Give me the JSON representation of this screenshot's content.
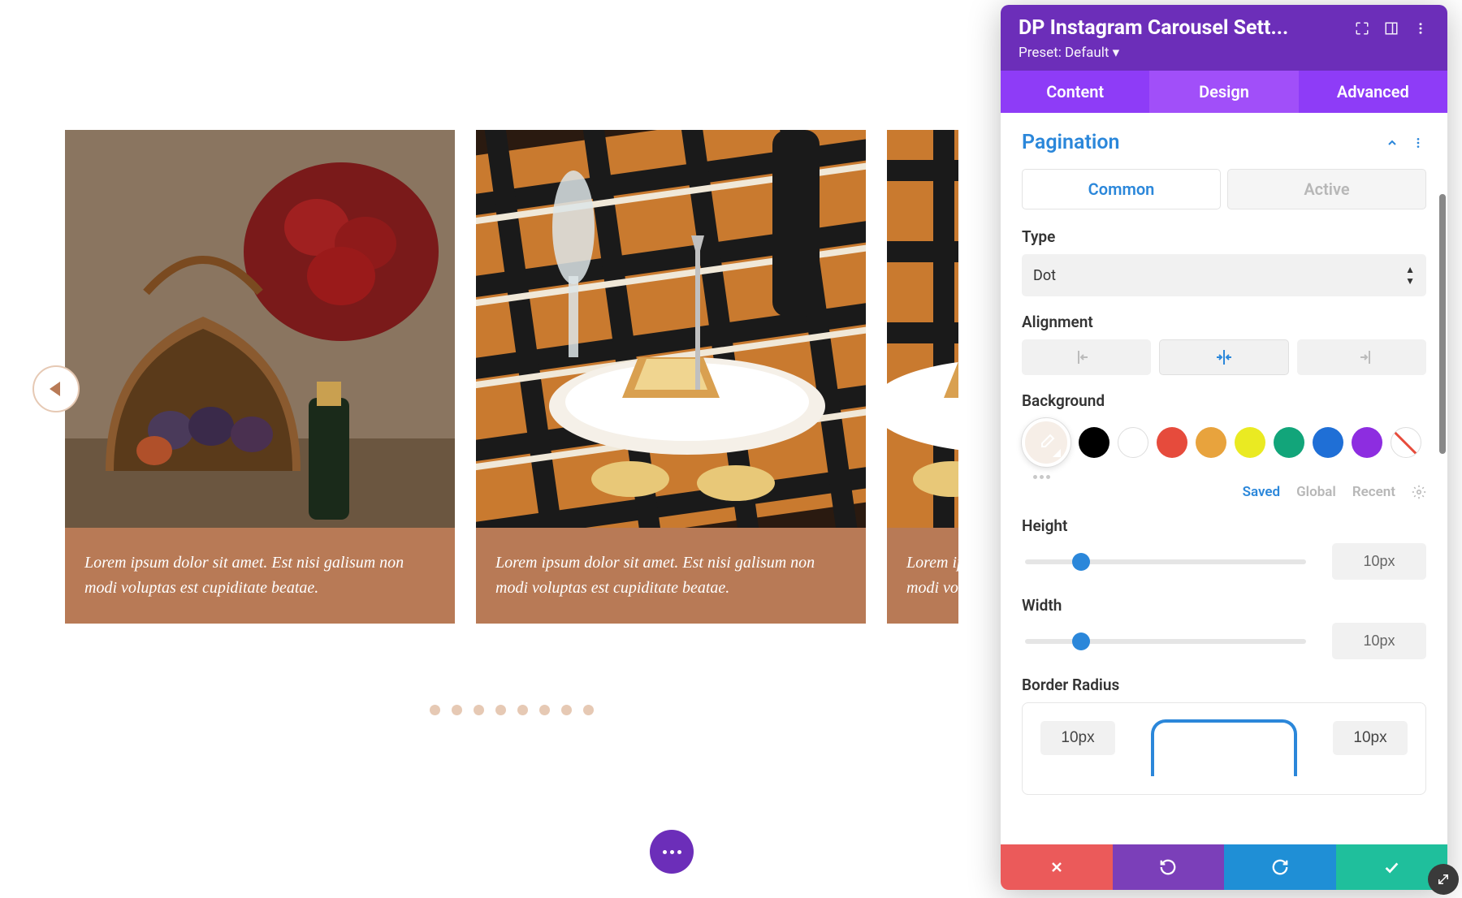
{
  "page_title": "DP Instagram Carousel Sett...",
  "preset_label": "Preset: Default ▾",
  "tabs": {
    "content": "Content",
    "design": "Design",
    "advanced": "Advanced"
  },
  "section": {
    "title": "Pagination"
  },
  "subtabs": {
    "common": "Common",
    "active": "Active"
  },
  "fields": {
    "type": {
      "label": "Type",
      "value": "Dot"
    },
    "alignment": {
      "label": "Alignment"
    },
    "background": {
      "label": "Background"
    },
    "height": {
      "label": "Height",
      "value": "10px",
      "pct": 20
    },
    "width": {
      "label": "Width",
      "value": "10px",
      "pct": 20
    },
    "border_radius": {
      "label": "Border Radius",
      "tl": "10px",
      "tr": "10px"
    }
  },
  "color_meta": {
    "saved": "Saved",
    "global": "Global",
    "recent": "Recent"
  },
  "swatches": [
    "#000000",
    "#ffffff",
    "#e64b3c",
    "#e8a33d",
    "#eaea22",
    "#12a57a",
    "#1f6fd6",
    "#8d2de0"
  ],
  "caption": "Lorem ipsum dolor sit amet. Est nisi galisum non modi voluptas est cupiditate beatae.",
  "dot_count": 8
}
